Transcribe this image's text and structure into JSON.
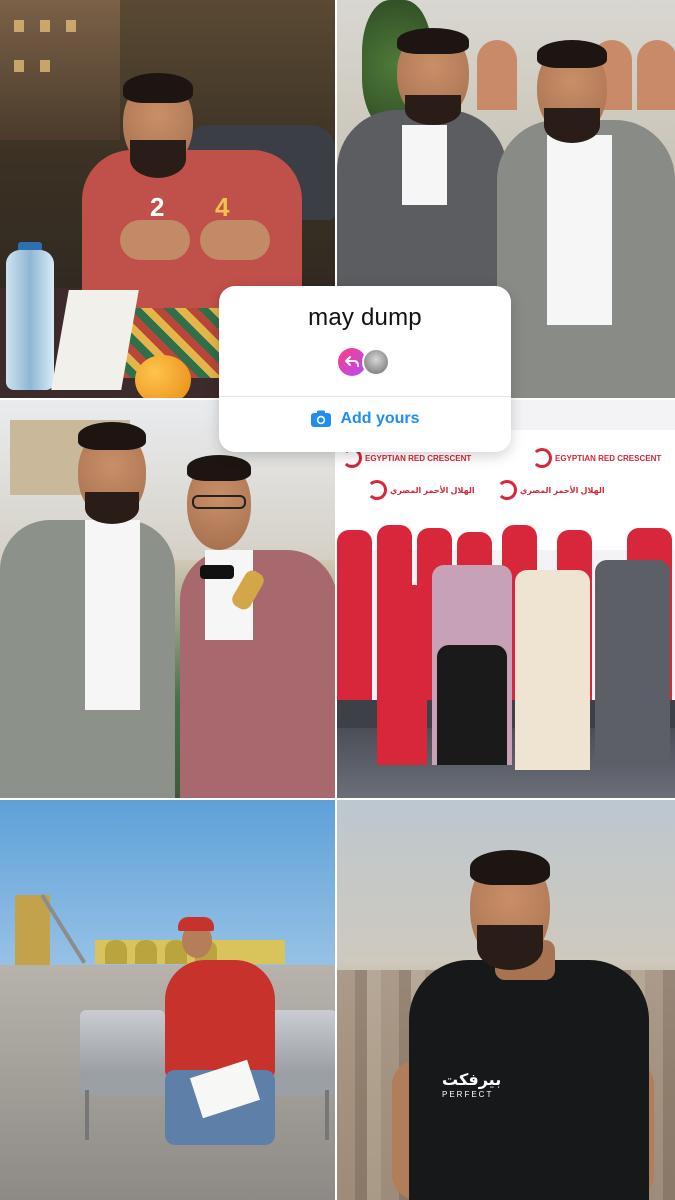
{
  "sticker": {
    "title": "may dump",
    "add_label": "Add yours",
    "icons": [
      "reply-icon",
      "user-avatar",
      "camera-icon"
    ]
  },
  "tiles": [
    {
      "name": "photo-birthday-cafe",
      "candle_digits": [
        "2",
        "4"
      ]
    },
    {
      "name": "photo-two-men-suits"
    },
    {
      "name": "photo-grey-and-maroon-suits"
    },
    {
      "name": "photo-red-crescent-group",
      "banner_text_ar": "الهلال الأحمر المصري",
      "banner_text_en": "EGYPTIAN RED CRESCENT"
    },
    {
      "name": "photo-port-bench"
    },
    {
      "name": "photo-rooftop-black-tee",
      "shirt_text_ar": "بيرفكت",
      "shirt_text_en": "PERFECT"
    }
  ],
  "colors": {
    "accent": "#1f8ef1",
    "red_crescent": "#d8263a"
  }
}
